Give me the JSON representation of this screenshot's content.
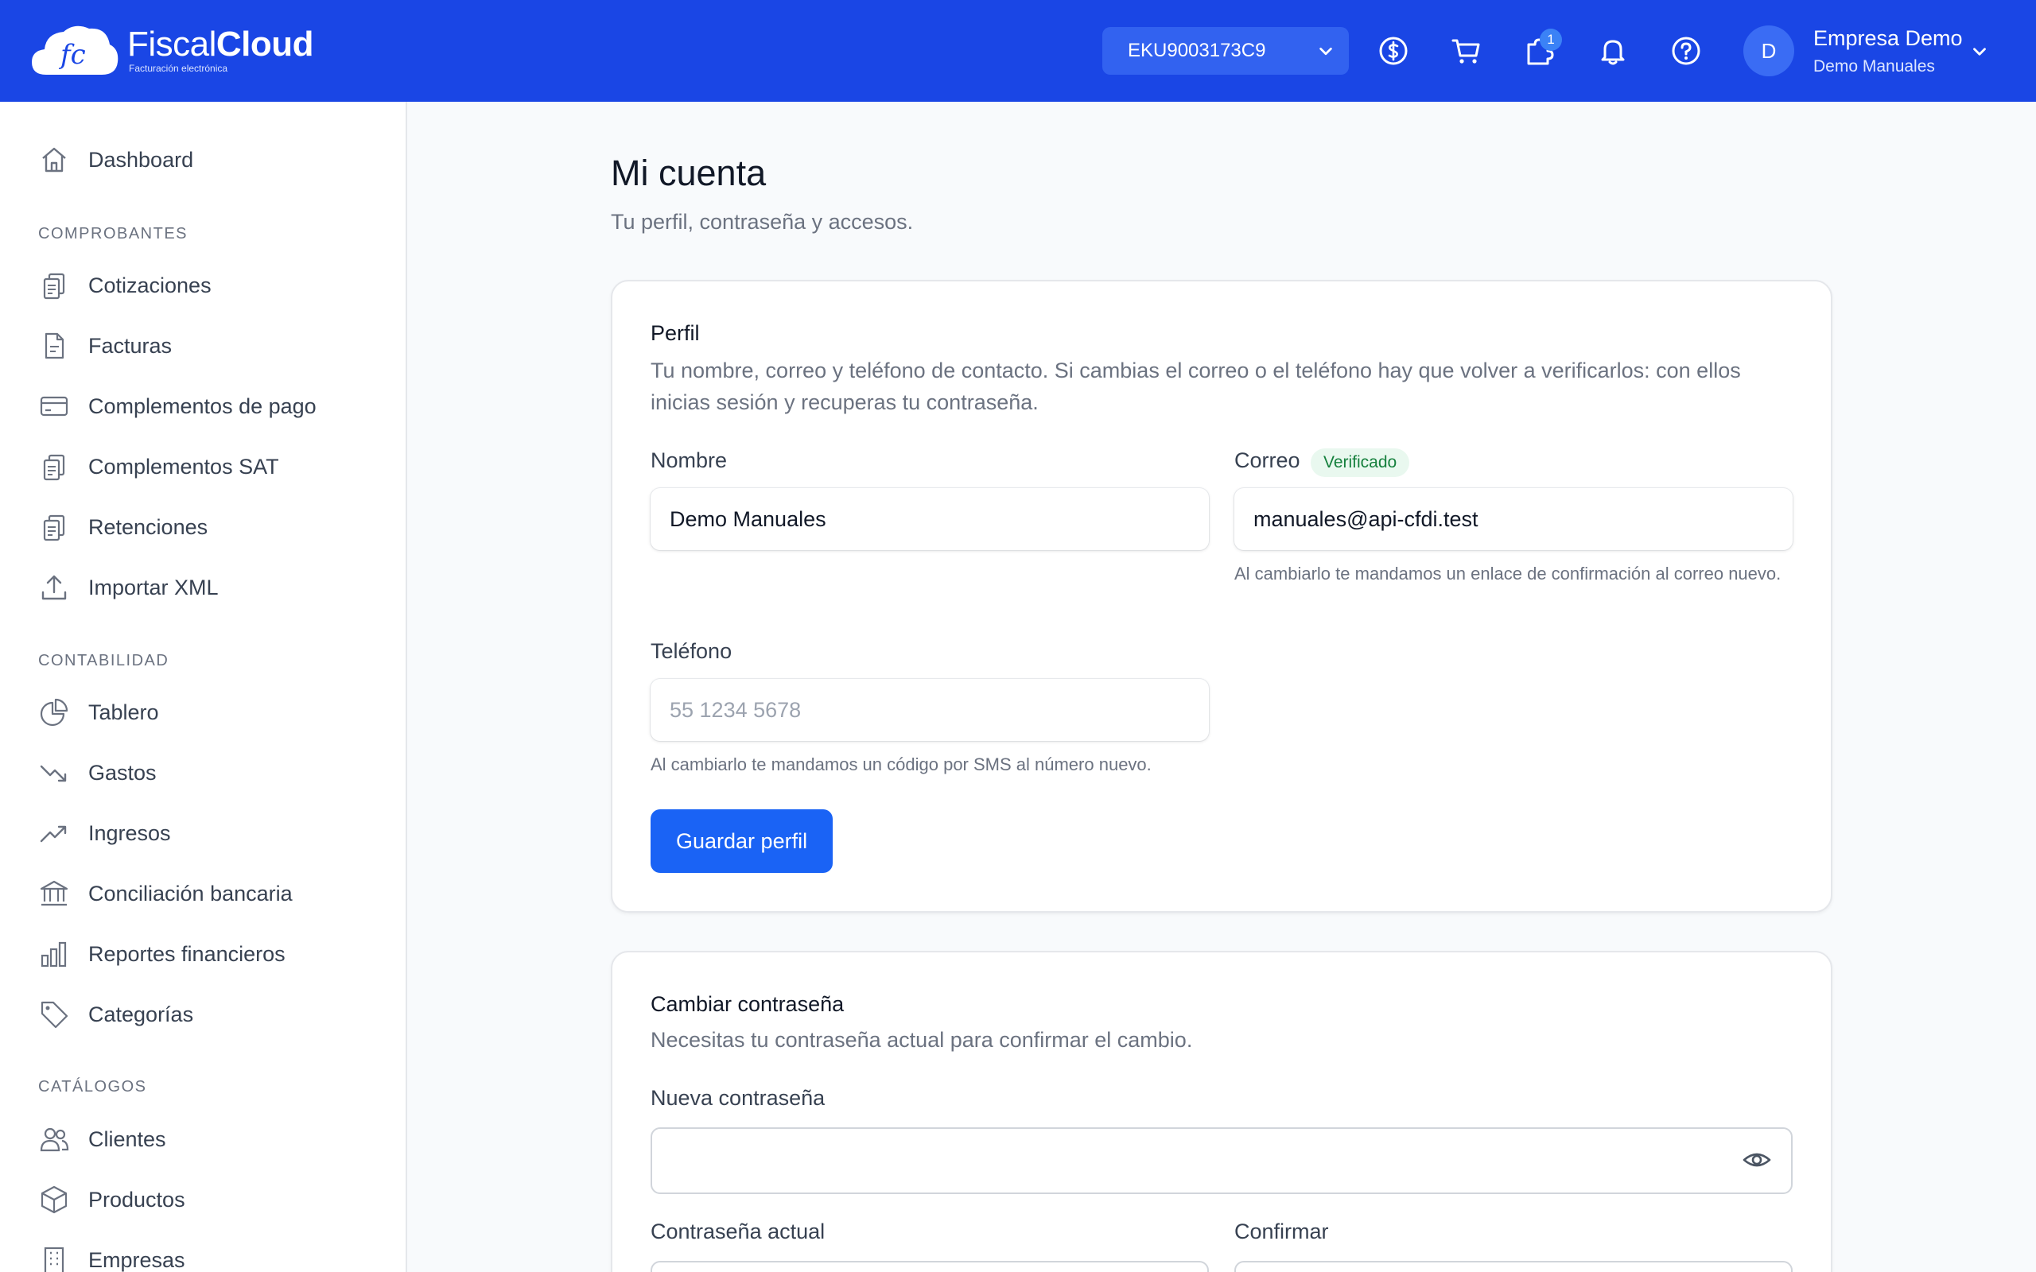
{
  "header": {
    "brand_light": "Fiscal",
    "brand_bold": "Cloud",
    "brand_tagline": "Facturación electrónica",
    "rfc_selected": "EKU9003173C9",
    "notifications_badge": "1",
    "user_company": "Empresa Demo",
    "user_name": "Demo Manuales",
    "avatar_initial": "D",
    "colors": {
      "bar": "#1a46e5",
      "accent": "#1a63f5"
    }
  },
  "sidebar": {
    "dashboard": "Dashboard",
    "sections": {
      "comprobantes": "COMPROBANTES",
      "contabilidad": "CONTABILIDAD",
      "catalogos": "CATÁLOGOS"
    },
    "comprobantes": [
      "Cotizaciones",
      "Facturas",
      "Complementos de pago",
      "Complementos SAT",
      "Retenciones",
      "Importar XML"
    ],
    "contabilidad": [
      "Tablero",
      "Gastos",
      "Ingresos",
      "Conciliación bancaria",
      "Reportes financieros",
      "Categorías"
    ],
    "catalogos": [
      "Clientes",
      "Productos",
      "Empresas"
    ]
  },
  "page": {
    "title": "Mi cuenta",
    "subtitle": "Tu perfil, contraseña y accesos."
  },
  "profile": {
    "title": "Perfil",
    "description": "Tu nombre, correo y teléfono de contacto. Si cambias el correo o el teléfono hay que volver a verificarlos: con ellos inicias sesión y recuperas tu contraseña.",
    "name_label": "Nombre",
    "name_value": "Demo Manuales",
    "email_label": "Correo",
    "email_badge": "Verificado",
    "email_value": "manuales@api-cfdi.test",
    "email_help": "Al cambiarlo te mandamos un enlace de confirmación al correo nuevo.",
    "phone_label": "Teléfono",
    "phone_placeholder": "55 1234 5678",
    "phone_help": "Al cambiarlo te mandamos un código por SMS al número nuevo.",
    "save_label": "Guardar perfil"
  },
  "password": {
    "title": "Cambiar contraseña",
    "description": "Necesitas tu contraseña actual para confirmar el cambio.",
    "new_label": "Nueva contraseña",
    "current_label": "Contraseña actual",
    "confirm_label": "Confirmar"
  }
}
